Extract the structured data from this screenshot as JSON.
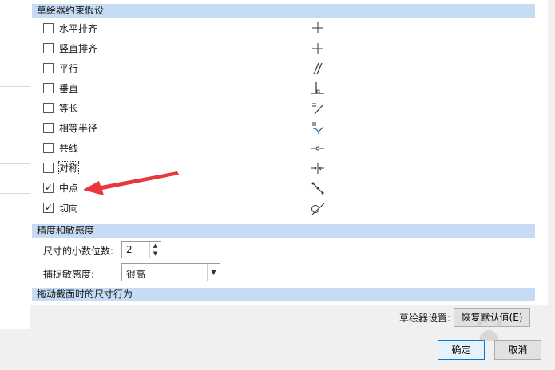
{
  "sections": {
    "constraints_header": "草绘器约束假设",
    "precision_header": "精度和敏感度",
    "drag_header": "拖动截面时的尺寸行为"
  },
  "constraints": [
    {
      "label": "水平排齐",
      "checked": false,
      "symbol": "horizontal-align-icon"
    },
    {
      "label": "竖直排齐",
      "checked": false,
      "symbol": "vertical-align-icon"
    },
    {
      "label": "平行",
      "checked": false,
      "symbol": "parallel-icon"
    },
    {
      "label": "垂直",
      "checked": false,
      "symbol": "perpendicular-icon"
    },
    {
      "label": "等长",
      "checked": false,
      "symbol": "equal-length-icon"
    },
    {
      "label": "相等半径",
      "checked": false,
      "symbol": "equal-radius-icon"
    },
    {
      "label": "共线",
      "checked": false,
      "symbol": "collinear-icon"
    },
    {
      "label": "对称",
      "checked": false,
      "symbol": "symmetric-icon"
    },
    {
      "label": "中点",
      "checked": true,
      "symbol": "midpoint-icon"
    },
    {
      "label": "切向",
      "checked": true,
      "symbol": "tangent-icon"
    }
  ],
  "precision": {
    "decimals_label": "尺寸的小数位数:",
    "decimals_value": "2",
    "snap_label": "捕捉敏感度:",
    "snap_value": "很高"
  },
  "footer": {
    "settings_label": "草绘器设置:",
    "restore_button": "恢复默认值(E)",
    "ok_button": "确定",
    "cancel_button": "取消"
  },
  "colors": {
    "section_header": "#c6dcf5",
    "annotation_arrow": "#e8383d",
    "default_button_border": "#0078d7"
  }
}
